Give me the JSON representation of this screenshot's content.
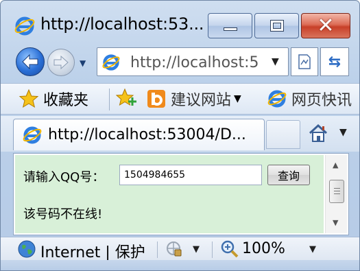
{
  "window": {
    "title": "http://localhost:53...",
    "colors": {
      "frame": "#bcd1ea",
      "close": "#c84029",
      "content_bg": "#d8f0d8"
    }
  },
  "navigation": {
    "address": "http://localhost:5",
    "icons": [
      "back-icon",
      "forward-icon",
      "ie-icon",
      "compatibility-icon",
      "refresh-icon"
    ]
  },
  "favorites": {
    "favorites_label": "收藏夹",
    "suggested_sites_label": "建议网站",
    "web_slices_label": "网页快讯"
  },
  "tab": {
    "label": "http://localhost:53004/D..."
  },
  "page": {
    "qq_label": "请输入QQ号：",
    "qq_value": "1504984655",
    "query_button": "查询",
    "result_text": "该号码不在线!"
  },
  "status": {
    "zone_text": "Internet | 保护",
    "zoom": "100%"
  }
}
